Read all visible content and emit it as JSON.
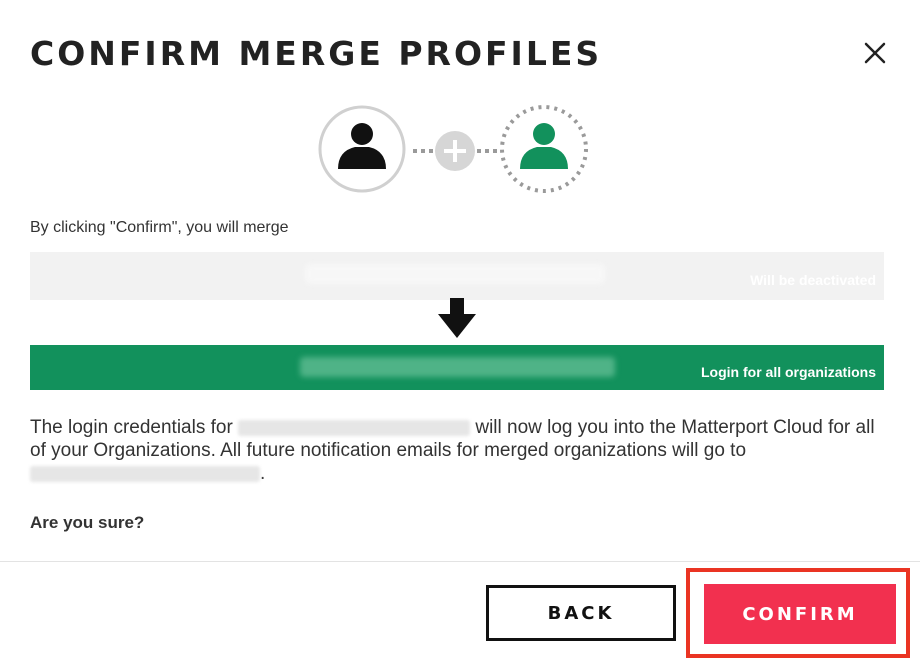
{
  "dialog": {
    "title": "CONFIRM MERGE PROFILES",
    "intro": "By clicking \"Confirm\", you will merge",
    "source_row": {
      "status": "Will be deactivated"
    },
    "target_row": {
      "status": "Login for all organizations"
    },
    "paragraph": {
      "part1": "The login credentials for ",
      "part2": " will now log you into the Matterport Cloud for all of your Organizations. All future notification emails for merged organizations will go to ",
      "part3": "."
    },
    "question": "Are you sure?",
    "buttons": {
      "back": "BACK",
      "confirm": "CONFIRM"
    }
  },
  "colors": {
    "green": "#12915c",
    "confirm": "#f2304f",
    "highlight": "#ea3423"
  },
  "icons": [
    "close-icon",
    "user-avatar-icon",
    "plus-icon",
    "arrow-down-icon"
  ]
}
